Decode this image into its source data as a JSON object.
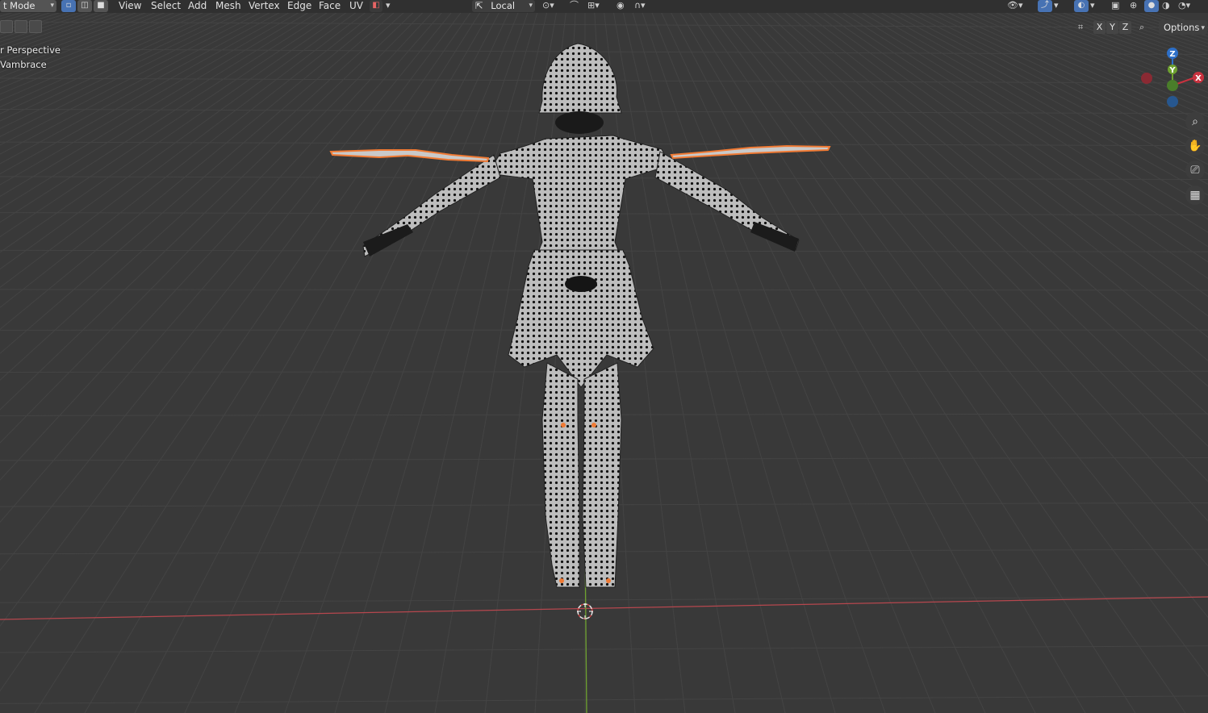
{
  "header": {
    "mode_label": "t Mode",
    "menus": [
      "View",
      "Select",
      "Add",
      "Mesh",
      "Vertex",
      "Edge",
      "Face",
      "UV"
    ],
    "orientation_label": "Local",
    "options_label": "Options",
    "axes": [
      "X",
      "Y",
      "Z"
    ]
  },
  "viewport": {
    "view_name": "r Perspective",
    "object_name": "Vambrace"
  },
  "gizmo": {
    "x": "X",
    "y": "Y",
    "z": "Z"
  },
  "colors": {
    "background": "#393939",
    "grid": "#444444",
    "x_axis": "#b6474e",
    "y_axis": "#6ea12f",
    "selection": "#f07a34",
    "mesh": "#b9b9b9",
    "active_button": "#4772b3"
  },
  "icons": [
    "zoom-icon",
    "hand-pan-icon",
    "camera-icon",
    "grid-ortho-icon"
  ]
}
